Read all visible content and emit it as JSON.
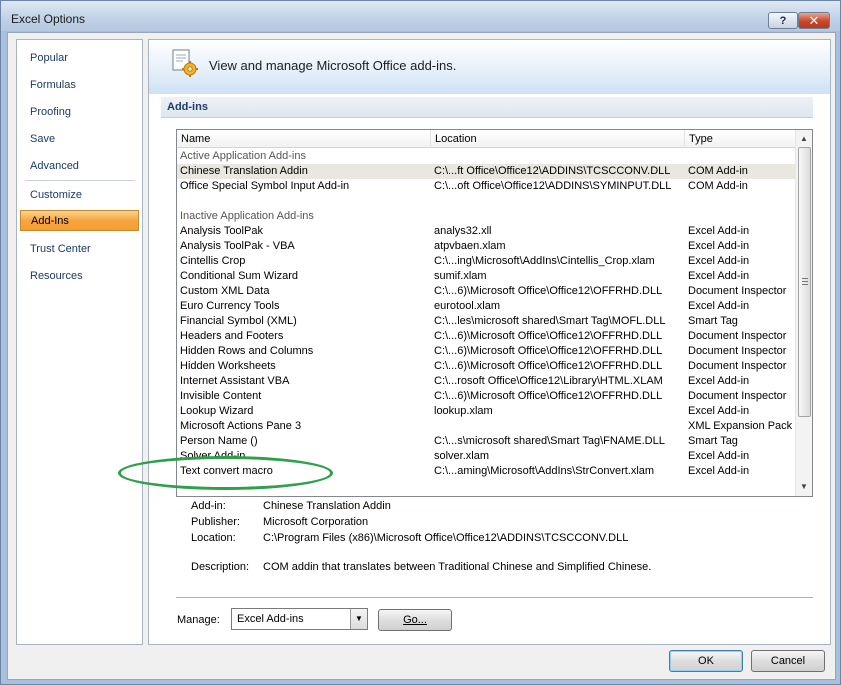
{
  "window": {
    "title": "Excel Options",
    "help_label": "?",
    "close_label": "✕"
  },
  "nav": {
    "items": [
      {
        "label": "Popular"
      },
      {
        "label": "Formulas"
      },
      {
        "label": "Proofing"
      },
      {
        "label": "Save"
      },
      {
        "label": "Advanced"
      },
      {
        "label": "Customize"
      },
      {
        "label": "Add-Ins"
      },
      {
        "label": "Trust Center"
      },
      {
        "label": "Resources"
      }
    ],
    "active": "Add-Ins"
  },
  "header": {
    "text": "View and manage Microsoft Office add-ins.",
    "icon": "add-ins-gear-icon"
  },
  "section": {
    "title": "Add-ins"
  },
  "list": {
    "columns": {
      "name": "Name",
      "location": "Location",
      "type": "Type"
    },
    "rows": [
      {
        "kind": "group",
        "name": "Active Application Add-ins",
        "location": "",
        "type": ""
      },
      {
        "kind": "item",
        "selected": true,
        "name": "Chinese Translation Addin",
        "location": "C:\\...ft Office\\Office12\\ADDINS\\TCSCCONV.DLL",
        "type": "COM Add-in"
      },
      {
        "kind": "item",
        "name": "Office Special Symbol Input Add-in",
        "location": "C:\\...oft Office\\Office12\\ADDINS\\SYMINPUT.DLL",
        "type": "COM Add-in"
      },
      {
        "kind": "spacer",
        "name": "",
        "location": "",
        "type": ""
      },
      {
        "kind": "group",
        "name": "Inactive Application Add-ins",
        "location": "",
        "type": ""
      },
      {
        "kind": "item",
        "name": "Analysis ToolPak",
        "location": "analys32.xll",
        "type": "Excel Add-in"
      },
      {
        "kind": "item",
        "name": "Analysis ToolPak - VBA",
        "location": "atpvbaen.xlam",
        "type": "Excel Add-in"
      },
      {
        "kind": "item",
        "name": "Cintellis Crop",
        "location": "C:\\...ing\\Microsoft\\AddIns\\Cintellis_Crop.xlam",
        "type": "Excel Add-in"
      },
      {
        "kind": "item",
        "name": "Conditional Sum Wizard",
        "location": "sumif.xlam",
        "type": "Excel Add-in"
      },
      {
        "kind": "item",
        "name": "Custom XML Data",
        "location": "C:\\...6)\\Microsoft Office\\Office12\\OFFRHD.DLL",
        "type": "Document Inspector"
      },
      {
        "kind": "item",
        "name": "Euro Currency Tools",
        "location": "eurotool.xlam",
        "type": "Excel Add-in"
      },
      {
        "kind": "item",
        "name": "Financial Symbol (XML)",
        "location": "C:\\...les\\microsoft shared\\Smart Tag\\MOFL.DLL",
        "type": "Smart Tag"
      },
      {
        "kind": "item",
        "name": "Headers and Footers",
        "location": "C:\\...6)\\Microsoft Office\\Office12\\OFFRHD.DLL",
        "type": "Document Inspector"
      },
      {
        "kind": "item",
        "name": "Hidden Rows and Columns",
        "location": "C:\\...6)\\Microsoft Office\\Office12\\OFFRHD.DLL",
        "type": "Document Inspector"
      },
      {
        "kind": "item",
        "name": "Hidden Worksheets",
        "location": "C:\\...6)\\Microsoft Office\\Office12\\OFFRHD.DLL",
        "type": "Document Inspector"
      },
      {
        "kind": "item",
        "name": "Internet Assistant VBA",
        "location": "C:\\...rosoft Office\\Office12\\Library\\HTML.XLAM",
        "type": "Excel Add-in"
      },
      {
        "kind": "item",
        "name": "Invisible Content",
        "location": "C:\\...6)\\Microsoft Office\\Office12\\OFFRHD.DLL",
        "type": "Document Inspector"
      },
      {
        "kind": "item",
        "name": "Lookup Wizard",
        "location": "lookup.xlam",
        "type": "Excel Add-in"
      },
      {
        "kind": "item",
        "name": "Microsoft Actions Pane 3",
        "location": "",
        "type": "XML Expansion Pack"
      },
      {
        "kind": "item",
        "name": "Person Name ()",
        "location": "C:\\...s\\microsoft shared\\Smart Tag\\FNAME.DLL",
        "type": "Smart Tag"
      },
      {
        "kind": "item",
        "name": "Solver Add-in",
        "location": "solver.xlam",
        "type": "Excel Add-in"
      },
      {
        "kind": "item",
        "name": "Text convert macro",
        "location": "C:\\...aming\\Microsoft\\AddIns\\StrConvert.xlam",
        "type": "Excel Add-in"
      }
    ]
  },
  "details": {
    "addin_label": "Add-in:",
    "addin_value": "Chinese Translation Addin",
    "publisher_label": "Publisher:",
    "publisher_value": "Microsoft Corporation",
    "location_label": "Location:",
    "location_value": "C:\\Program Files (x86)\\Microsoft Office\\Office12\\ADDINS\\TCSCCONV.DLL",
    "description_label": "Description:",
    "description_value": "COM addin that translates between Traditional Chinese and Simplified Chinese."
  },
  "manage": {
    "label": "Manage:",
    "selected": "Excel Add-ins",
    "go_label": "Go..."
  },
  "footer": {
    "ok_label": "OK",
    "cancel_label": "Cancel"
  },
  "colors": {
    "active_nav": "#f8a53f",
    "annotation": "#2ea04a"
  }
}
